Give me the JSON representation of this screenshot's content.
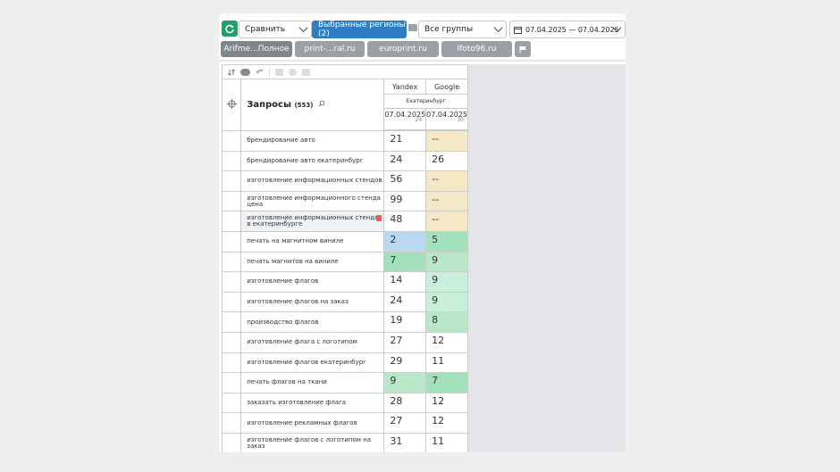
{
  "toolbar": {
    "compare_label": "Сравнить",
    "regions_label": "Выбранные регионы (2)",
    "groups_label": "Все группы",
    "date_range": "07.04.2025 — 07.04.2025"
  },
  "tabs": [
    {
      "label": "Arifme...Полное"
    },
    {
      "label": "print-...ral.ru"
    },
    {
      "label": "europrint.ru"
    },
    {
      "label": "lfoto96.ru"
    }
  ],
  "table": {
    "title": "Запросы",
    "count": "(553)",
    "engines": [
      "Yandex",
      "Google"
    ],
    "region": "Екатеринбург",
    "dates": [
      "07.04.2025",
      "07.04.2025"
    ],
    "date_subs": [
      "24",
      "30"
    ],
    "rows": [
      {
        "q": "брендирование авто",
        "y": "21",
        "g": "--"
      },
      {
        "q": "брендирование авто екатеринбург",
        "y": "24",
        "g": "26"
      },
      {
        "q": "изготовление информационных стендов",
        "y": "56",
        "g": "--"
      },
      {
        "q": "изготовление информационного стенда цена",
        "y": "99",
        "g": "--"
      },
      {
        "q": "изготовление информационных стендов в екатеринбурге",
        "y": "48",
        "g": "--"
      },
      {
        "q": "печать на магнитном виниле",
        "y": "2",
        "g": "5"
      },
      {
        "q": "печать магнитов на виниле",
        "y": "7",
        "g": "9"
      },
      {
        "q": "изготовление флагов",
        "y": "14",
        "g": "9"
      },
      {
        "q": "изготовление флагов на заказ",
        "y": "24",
        "g": "9"
      },
      {
        "q": "производство флагов",
        "y": "19",
        "g": "8"
      },
      {
        "q": "изготовление флага с логотипом",
        "y": "27",
        "g": "12"
      },
      {
        "q": "изготовление флагов екатеринбург",
        "y": "29",
        "g": "11"
      },
      {
        "q": "печать флагов на ткани",
        "y": "9",
        "g": "7"
      },
      {
        "q": "заказать изготовление флага",
        "y": "28",
        "g": "12"
      },
      {
        "q": "изготовление рекламных флагов",
        "y": "27",
        "g": "12"
      },
      {
        "q": "изготовление флагов с логотипом на заказ",
        "y": "31",
        "g": "11"
      }
    ]
  },
  "colors": {
    "accent": "#2f7ec3",
    "refresh": "#23a06a",
    "cell_yellow": "#f4e8c6",
    "cell_green": "#b9e8c9",
    "cell_blue": "#b8d9ef"
  }
}
